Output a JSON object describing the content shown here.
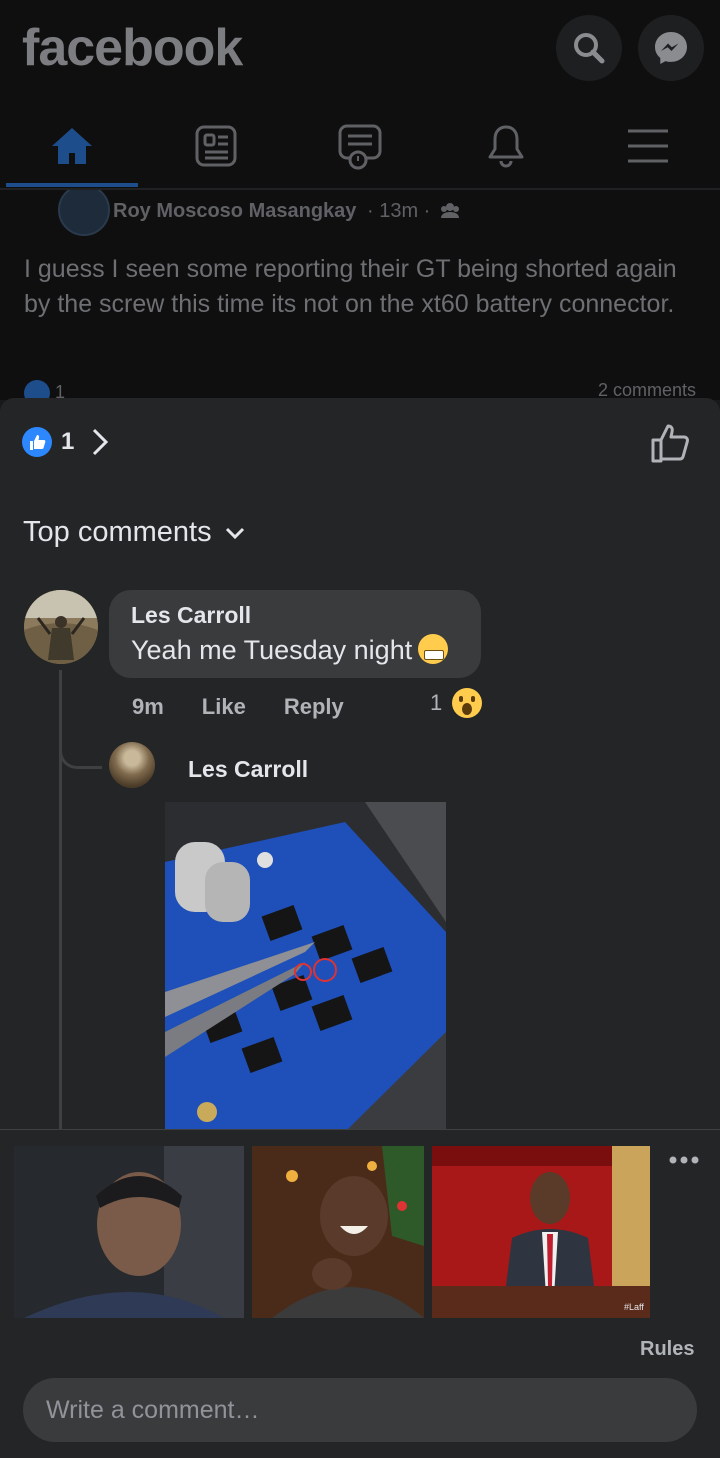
{
  "header": {
    "logo": "facebook",
    "search_icon": "search-icon",
    "messenger_icon": "messenger-icon"
  },
  "nav": {
    "tabs": [
      {
        "name": "home-icon",
        "active": true
      },
      {
        "name": "news-icon",
        "active": false
      },
      {
        "name": "watch-icon",
        "active": false
      },
      {
        "name": "bell-icon",
        "active": false
      },
      {
        "name": "menu-icon",
        "active": false
      }
    ],
    "accent_color": "#2d88ff"
  },
  "post": {
    "author": "Roy Moscoso Masangkay",
    "meta": "· 13m ·",
    "text": "I guess I seen some reporting their GT being shorted again by the screw this time its not on the xt60 battery connector.",
    "likes": "1",
    "comments": "2 comments"
  },
  "sheet": {
    "reaction_count": "1",
    "top_comments_label": "Top comments",
    "comment": {
      "author": "Les Carroll",
      "text": "Yeah me Tuesday night",
      "time": "9m",
      "like_label": "Like",
      "reply_label": "Reply",
      "reaction_count": "1"
    },
    "reply": {
      "author": "Les Carroll"
    },
    "gif_watermark": "#Laff",
    "rules_label": "Rules",
    "input_placeholder": "Write a comment…"
  }
}
